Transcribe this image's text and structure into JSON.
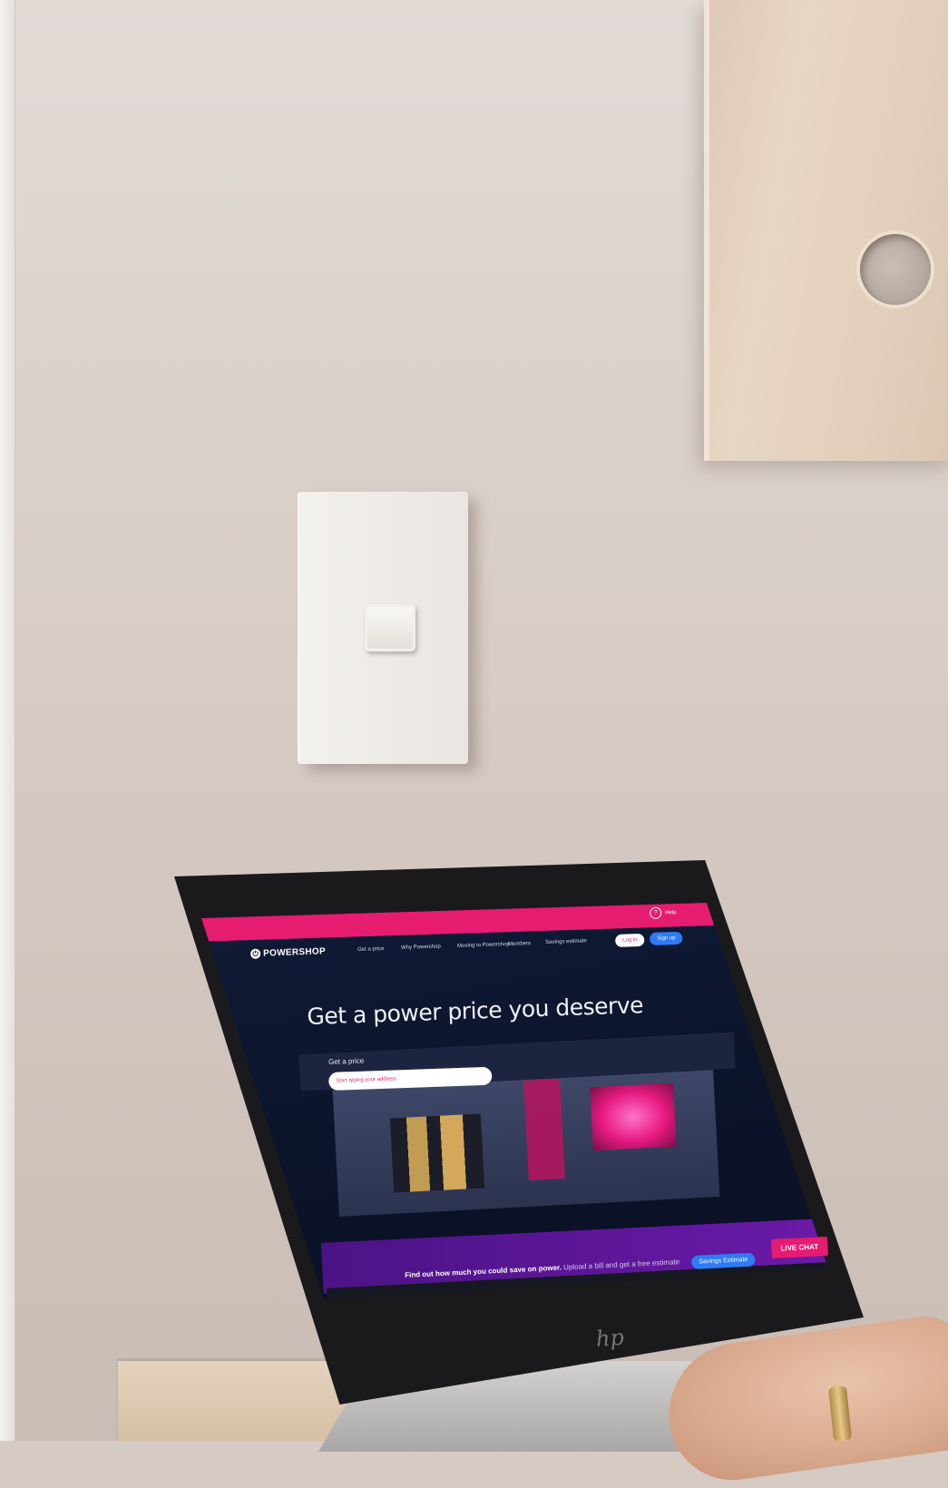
{
  "site": {
    "brand": "POWERSHOP",
    "help_label": "Help",
    "nav": [
      "Get a price",
      "Why Powershop",
      "Moving to Powershop",
      "Members",
      "Savings estimate"
    ],
    "login_label": "Log in",
    "signup_label": "Sign up",
    "hero_title": "Get a power price you deserve",
    "quote_label": "Get a price",
    "quote_placeholder": "Start typing your address",
    "banner_bold": "Find out how much you could save on power.",
    "banner_text": " Upload a bill and get a free estimate",
    "savings_button": "Savings Estimate",
    "chat_button": "LIVE CHAT"
  },
  "laptop": {
    "brand_mark": "hp"
  },
  "colors": {
    "brand_pink": "#e61c71",
    "navy": "#0d1b36",
    "purple": "#5a169a",
    "blue": "#2f7bf5"
  }
}
